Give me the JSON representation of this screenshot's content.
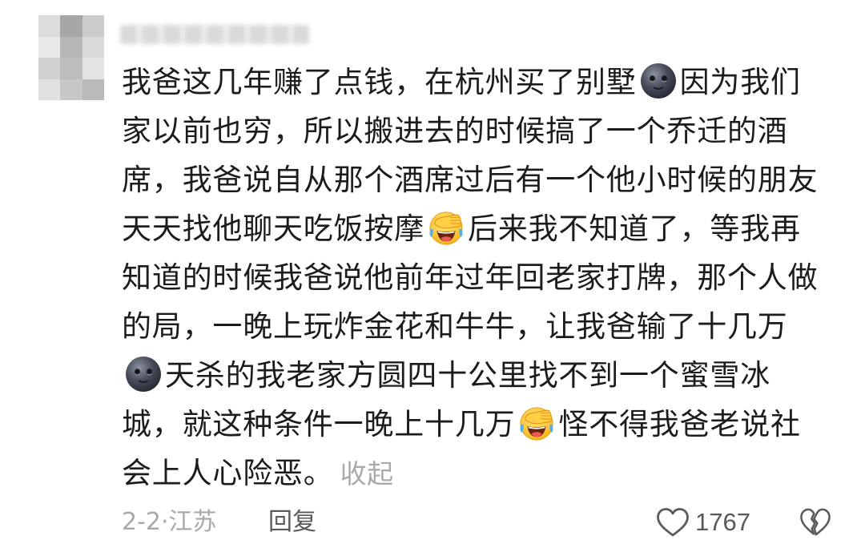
{
  "comment": {
    "lines": [
      [
        "我爸这几年赚了点钱，在杭州买了别墅",
        {
          "emoji": "new-moon-face"
        },
        "因为我们"
      ],
      [
        "家以前也穷，所以搬进去的时候搞了一个乔迁的酒"
      ],
      [
        "席，我爸说自从那个酒席过后有一个他小时候的朋友"
      ],
      [
        "天天找他聊天吃饭按摩",
        {
          "emoji": "laughing-facepalm"
        },
        "后来我不知道了，等我再"
      ],
      [
        "知道的时候我爸说他前年过年回老家打牌，那个人做"
      ],
      [
        "的局，一晚上玩炸金花和牛牛，让我爸输了十几万"
      ],
      [
        {
          "emoji": "new-moon-face"
        },
        "天杀的我老家方圆四十公里找不到一个蜜雪冰"
      ],
      [
        "城，就这种条件一晚上十几万",
        {
          "emoji": "laughing-facepalm"
        },
        "怪不得我爸老说社"
      ],
      [
        "会上人心险恶。"
      ]
    ],
    "collapse_label": "收起"
  },
  "meta": {
    "date_location": "2-2·江苏",
    "reply_label": "回复",
    "like_count": "1767"
  },
  "icons": {
    "like": "heart-outline-icon",
    "dislike": "broken-heart-icon"
  },
  "colors": {
    "text": "#1c1c1c",
    "muted": "#a9a9a9",
    "secondary": "#595959"
  }
}
